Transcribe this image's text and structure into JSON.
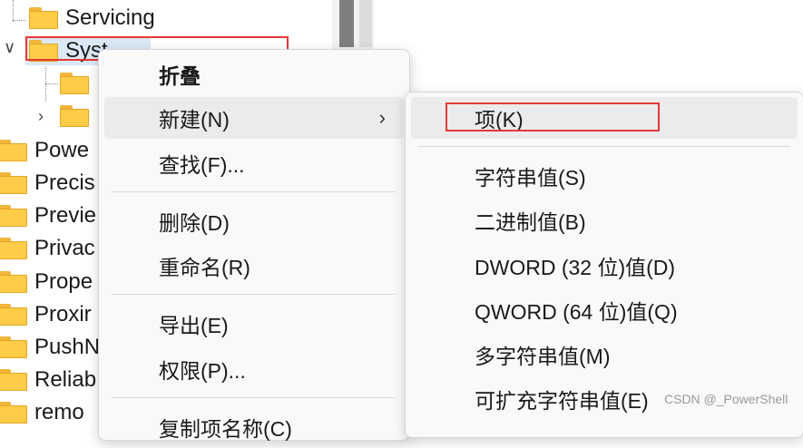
{
  "tree": {
    "items": [
      {
        "label": "Servicing"
      },
      {
        "label": "Syst"
      },
      {
        "label": ""
      },
      {
        "label": ""
      },
      {
        "label": "Powe"
      },
      {
        "label": "Precis"
      },
      {
        "label": "Previe"
      },
      {
        "label": "Privac"
      },
      {
        "label": "Prope"
      },
      {
        "label": "Proxir"
      },
      {
        "label": "PushN"
      },
      {
        "label": "Reliab"
      },
      {
        "label": "remo"
      }
    ]
  },
  "context_menu": {
    "items": [
      {
        "label": "折叠"
      },
      {
        "label": "新建(N)"
      },
      {
        "label": "查找(F)..."
      },
      {
        "label": "删除(D)"
      },
      {
        "label": "重命名(R)"
      },
      {
        "label": "导出(E)"
      },
      {
        "label": "权限(P)..."
      },
      {
        "label": "复制项名称(C)"
      }
    ]
  },
  "submenu": {
    "items": [
      {
        "label": "项(K)"
      },
      {
        "label": "字符串值(S)"
      },
      {
        "label": "二进制值(B)"
      },
      {
        "label": "DWORD (32 位)值(D)"
      },
      {
        "label": "QWORD (64 位)值(Q)"
      },
      {
        "label": "多字符串值(M)"
      },
      {
        "label": "可扩充字符串值(E)"
      }
    ]
  },
  "watermark": "CSDN @_PowerShell",
  "colors": {
    "highlight": "#e53935",
    "selected": "#dbe9f6",
    "folder": "#ffcc47"
  }
}
